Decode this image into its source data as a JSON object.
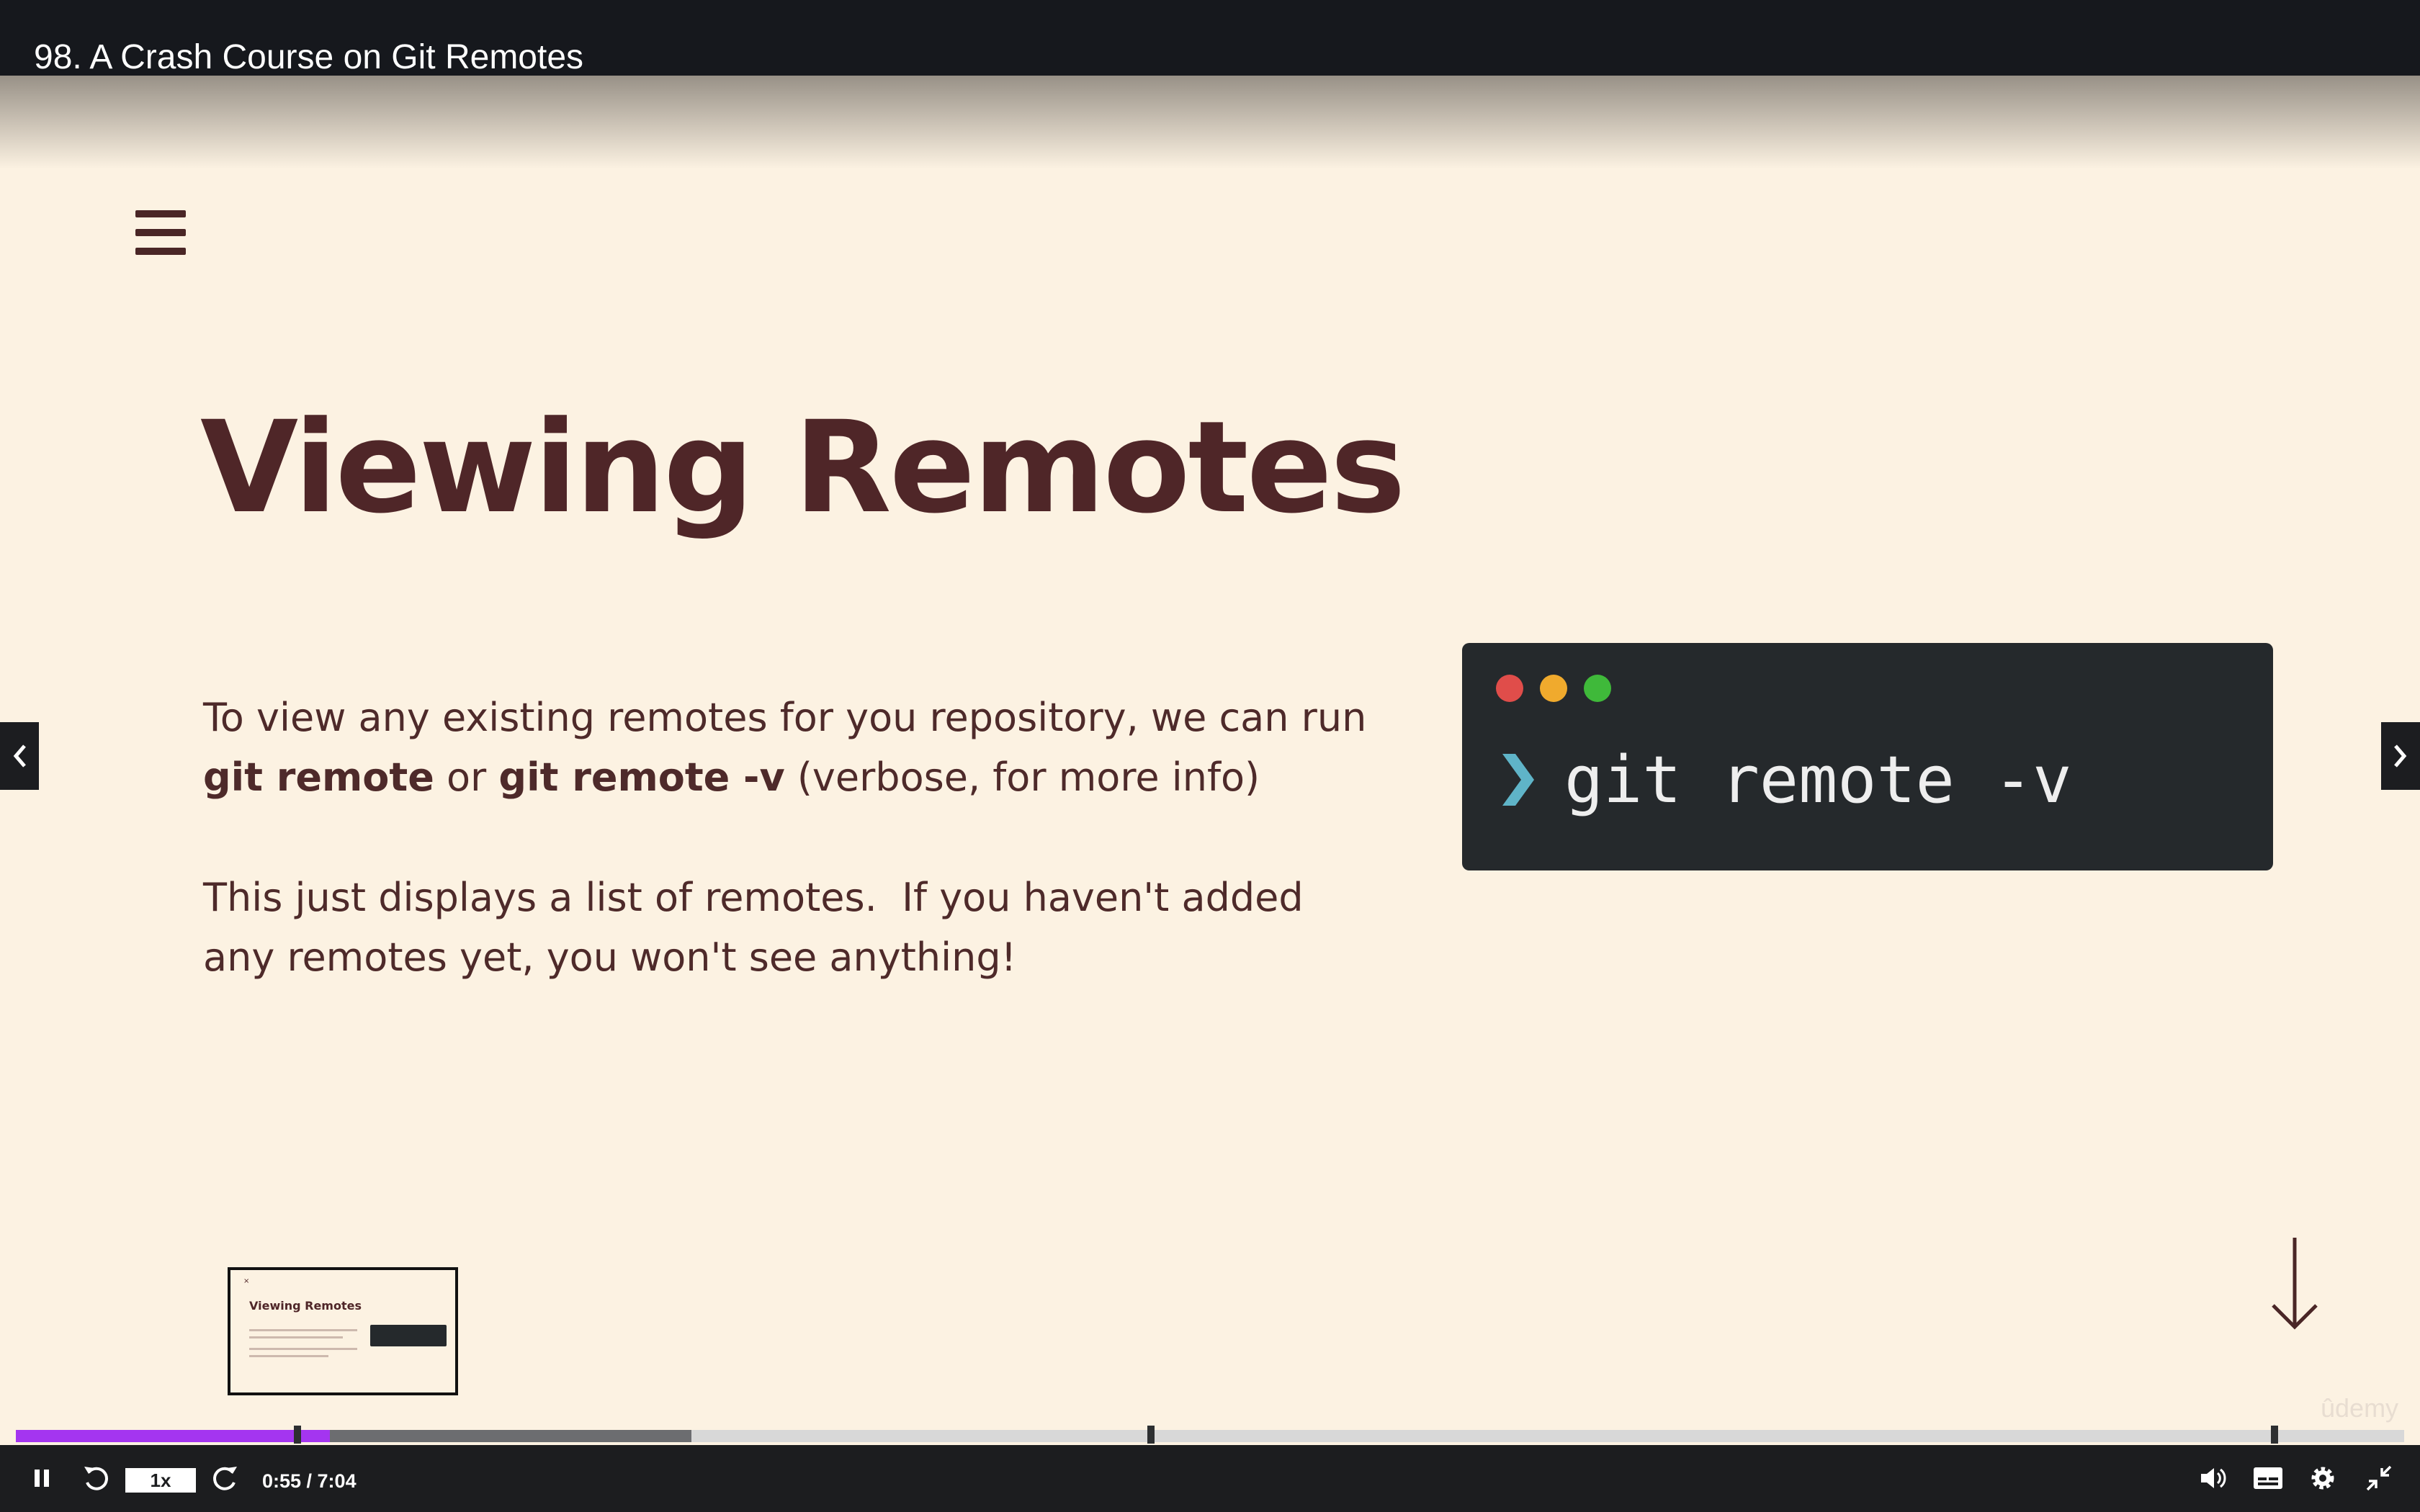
{
  "header": {
    "title": "98. A Crash Course on Git Remotes"
  },
  "slide": {
    "title": "Viewing Remotes",
    "para1": {
      "line1": "To view any existing remotes for you repository, we can run",
      "cmd1": "git remote",
      "or": " or ",
      "cmd2": "git remote -v",
      "tail": " (verbose, for more info)"
    },
    "para2": {
      "line1": "This just displays a list of remotes.  If you haven't added",
      "line2": "any remotes yet, you won't see anything!"
    },
    "terminal": {
      "command": "git remote -v",
      "prompt_icon": "chevron-right-icon"
    }
  },
  "thumbnail": {
    "title": "Viewing Remotes"
  },
  "watermark": "ûdemy",
  "player": {
    "playback_rate": "1x",
    "current_time": "0:55",
    "duration": "7:04",
    "time_display": "0:55 / 7:04",
    "progress_fraction": 0.13,
    "accent_color": "#a435f0"
  },
  "icons": {
    "pause": "pause-icon",
    "rewind": "rewind-5-icon",
    "forward": "forward-5-icon",
    "volume": "volume-icon",
    "captions": "captions-icon",
    "settings": "gear-icon",
    "exit_fullscreen": "exit-fullscreen-icon",
    "prev": "chevron-left-icon",
    "next": "chevron-right-icon",
    "menu": "hamburger-menu-icon",
    "down": "arrow-down-icon"
  }
}
